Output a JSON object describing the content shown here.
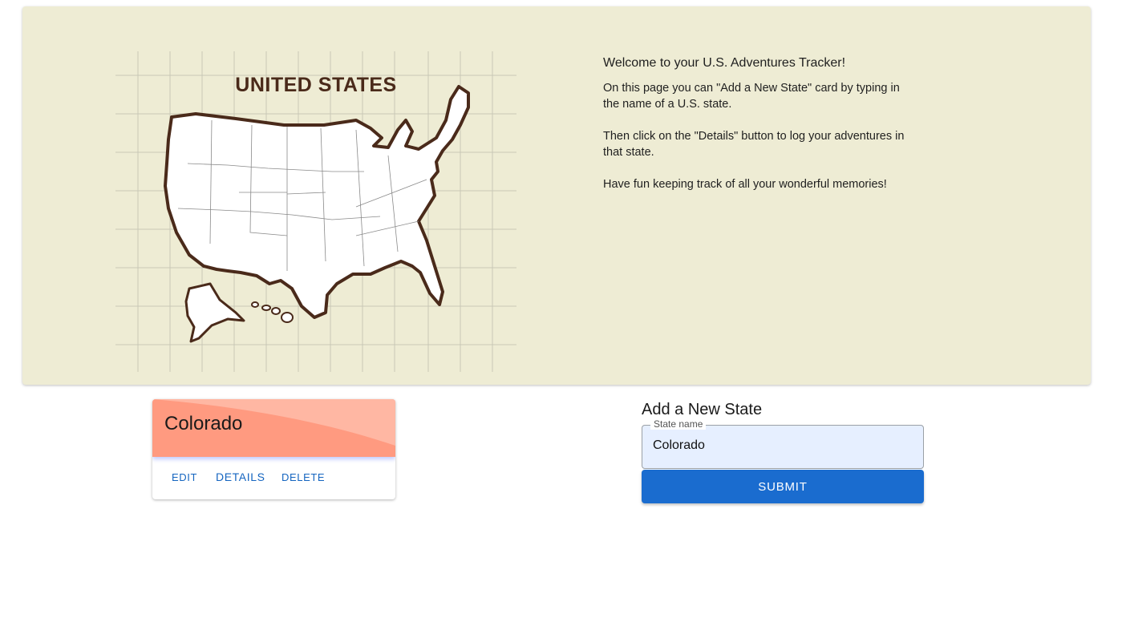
{
  "map": {
    "title": "UNITED STATES"
  },
  "welcome": {
    "heading": "Welcome to your U.S. Adventures Tracker!",
    "paragraph1": "On this page you can \"Add a New State\" card by typing in the name of a U.S. state.",
    "paragraph2": "Then click on the \"Details\" button to log your adventures in that state.",
    "paragraph3": "Have fun keeping track of all your wonderful memories!"
  },
  "state_card": {
    "name": "Colorado",
    "edit_label": "EDIT",
    "details_label": "DETAILS",
    "delete_label": "DELETE",
    "header_color": "#ff9a80"
  },
  "add_form": {
    "title": "Add a New State",
    "field_label": "State name",
    "field_value": "Colorado",
    "submit_label": "SUBMIT",
    "accent_color": "#1a6ccf"
  }
}
